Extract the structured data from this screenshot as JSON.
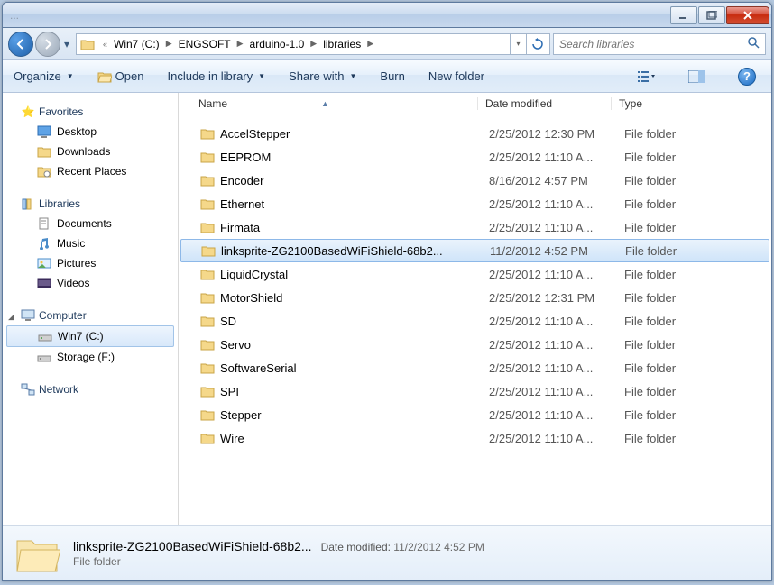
{
  "titlebar": {
    "text": "..."
  },
  "breadcrumb": {
    "segments": [
      "Win7 (C:)",
      "ENGSOFT",
      "arduino-1.0",
      "libraries"
    ]
  },
  "search": {
    "placeholder": "Search libraries"
  },
  "toolbar": {
    "organize": "Organize",
    "open": "Open",
    "include": "Include in library",
    "share": "Share with",
    "burn": "Burn",
    "newfolder": "New folder"
  },
  "sidebar": {
    "favorites": {
      "label": "Favorites",
      "items": [
        "Desktop",
        "Downloads",
        "Recent Places"
      ]
    },
    "libraries": {
      "label": "Libraries",
      "items": [
        "Documents",
        "Music",
        "Pictures",
        "Videos"
      ]
    },
    "computer": {
      "label": "Computer",
      "items": [
        "Win7 (C:)",
        "Storage (F:)"
      ]
    },
    "network": {
      "label": "Network"
    }
  },
  "columns": {
    "name": "Name",
    "date": "Date modified",
    "type": "Type"
  },
  "files": [
    {
      "name": "AccelStepper",
      "date": "2/25/2012 12:30 PM",
      "type": "File folder"
    },
    {
      "name": "EEPROM",
      "date": "2/25/2012 11:10 A...",
      "type": "File folder"
    },
    {
      "name": "Encoder",
      "date": "8/16/2012 4:57 PM",
      "type": "File folder"
    },
    {
      "name": "Ethernet",
      "date": "2/25/2012 11:10 A...",
      "type": "File folder"
    },
    {
      "name": "Firmata",
      "date": "2/25/2012 11:10 A...",
      "type": "File folder"
    },
    {
      "name": "linksprite-ZG2100BasedWiFiShield-68b2...",
      "date": "11/2/2012 4:52 PM",
      "type": "File folder",
      "selected": true
    },
    {
      "name": "LiquidCrystal",
      "date": "2/25/2012 11:10 A...",
      "type": "File folder"
    },
    {
      "name": "MotorShield",
      "date": "2/25/2012 12:31 PM",
      "type": "File folder"
    },
    {
      "name": "SD",
      "date": "2/25/2012 11:10 A...",
      "type": "File folder"
    },
    {
      "name": "Servo",
      "date": "2/25/2012 11:10 A...",
      "type": "File folder"
    },
    {
      "name": "SoftwareSerial",
      "date": "2/25/2012 11:10 A...",
      "type": "File folder"
    },
    {
      "name": "SPI",
      "date": "2/25/2012 11:10 A...",
      "type": "File folder"
    },
    {
      "name": "Stepper",
      "date": "2/25/2012 11:10 A...",
      "type": "File folder"
    },
    {
      "name": "Wire",
      "date": "2/25/2012 11:10 A...",
      "type": "File folder"
    }
  ],
  "details": {
    "name": "linksprite-ZG2100BasedWiFiShield-68b2...",
    "type": "File folder",
    "date_label": "Date modified:",
    "date": "11/2/2012 4:52 PM"
  }
}
